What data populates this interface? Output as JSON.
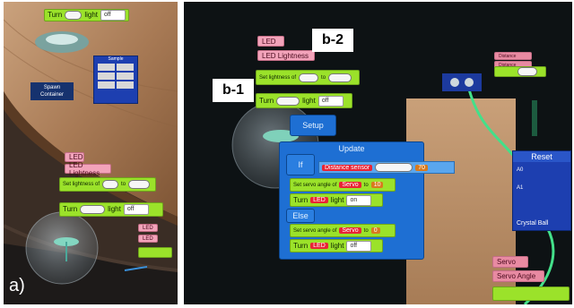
{
  "panel_a": {
    "label": "a)",
    "spawn_button": "Spawn\nContainer",
    "board_title": "Sample",
    "turn_block": {
      "turn": "Turn",
      "light": "light",
      "state": "off"
    },
    "top_turn_block": {
      "turn": "Turn",
      "light": "light",
      "state": "off"
    },
    "led": "LED",
    "led_lightness": "LED Lightness",
    "set_lightness": {
      "label": "Set lightness of",
      "to": "to"
    },
    "small_tags": [
      "LED",
      "LED"
    ]
  },
  "panel_b": {
    "label_b1": "b-1",
    "label_b2": "b-2",
    "led": "LED",
    "led_lightness": "LED Lightness",
    "set_lightness": {
      "label": "Set lightness of",
      "to": "to"
    },
    "turn_block": {
      "turn": "Turn",
      "light": "light",
      "state": "off"
    },
    "setup": "Setup",
    "update": "Update",
    "if_label": "If",
    "else_label": "Else",
    "cond_text": "Distance sensor",
    "cond_value": "70",
    "if_servo": {
      "label": "Set servo angle of",
      "target": "Servo",
      "to": "to",
      "value": "10"
    },
    "if_turn": {
      "turn": "Turn",
      "led": "LED",
      "light": "light",
      "state": "on"
    },
    "else_servo": {
      "label": "Set servo angle of",
      "target": "Servo",
      "to": "to",
      "value": "0"
    },
    "else_turn": {
      "turn": "Turn",
      "led": "LED",
      "light": "light",
      "state": "off"
    },
    "reset": "Reset",
    "board_pins": [
      "A0",
      "A1"
    ],
    "crystal_ball": "Crystal Ball",
    "servo": "Servo",
    "servo_angle": "Servo Angle",
    "right_tags": [
      "Distance",
      "Distance"
    ]
  },
  "colors": {
    "green_block": "#9be22a",
    "pink_block": "#f2a3ba",
    "blue_block": "#1e6fd3"
  }
}
